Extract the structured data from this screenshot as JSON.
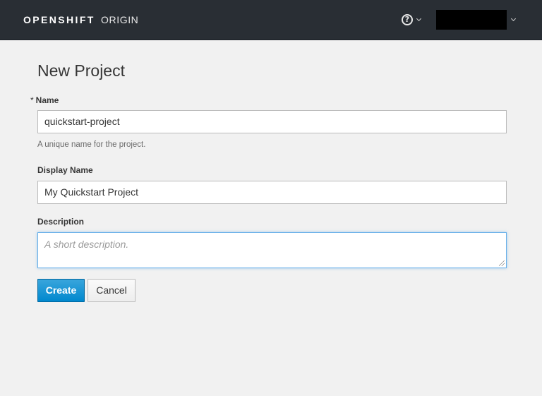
{
  "navbar": {
    "brand_bold": "OPENSHIFT",
    "brand_light": "ORIGIN",
    "help_icon": "question-circle-icon",
    "user_name": ""
  },
  "page": {
    "title": "New Project"
  },
  "form": {
    "name": {
      "required_marker": "*",
      "label": "Name",
      "value": "quickstart-project",
      "help": "A unique name for the project."
    },
    "display_name": {
      "label": "Display Name",
      "value": "My Quickstart Project"
    },
    "description": {
      "label": "Description",
      "placeholder": "A short description.",
      "value": ""
    }
  },
  "actions": {
    "create_label": "Create",
    "cancel_label": "Cancel"
  },
  "colors": {
    "navbar_bg": "#292e34",
    "page_bg": "#f1f1f1",
    "primary": "#0088ce",
    "focus_border": "#66afe9"
  }
}
